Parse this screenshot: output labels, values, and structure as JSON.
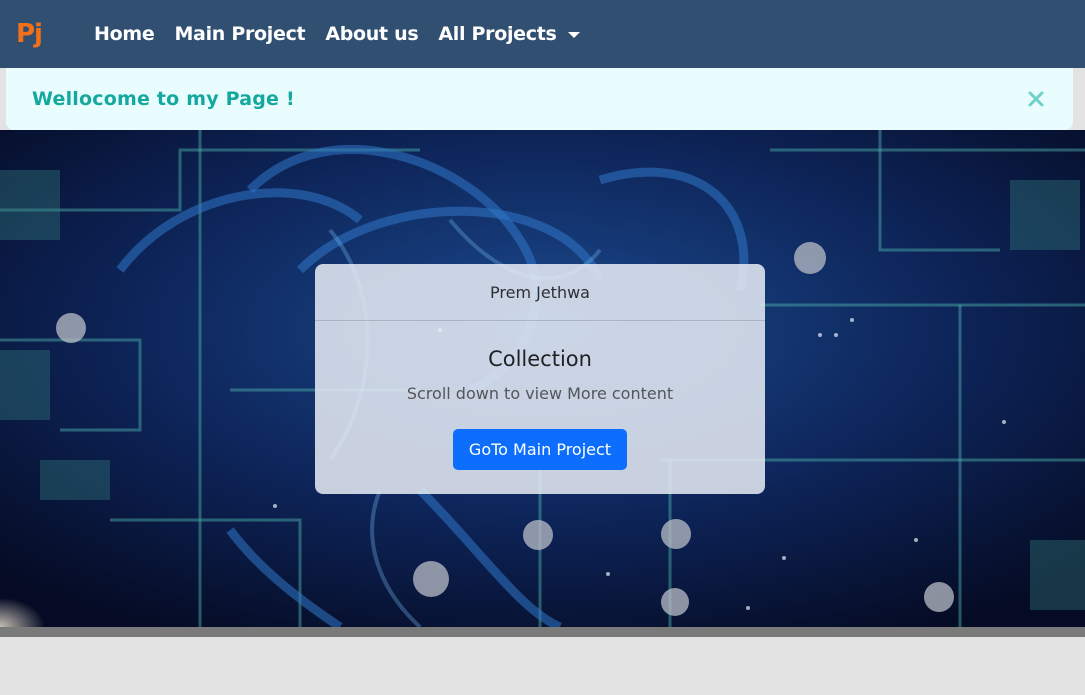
{
  "navbar": {
    "brand": "Pj",
    "links": [
      "Home",
      "Main Project",
      "About us"
    ],
    "dropdown_label": "All Projects",
    "background": "#304f71",
    "brand_color": "#f27118"
  },
  "alert": {
    "message": "Wellocome to my Page !",
    "close_icon": "close-icon",
    "text_color": "#14a89e"
  },
  "card": {
    "header": "Prem Jethwa",
    "title": "Collection",
    "text": "Scroll down to view More content",
    "button_label": "GoTo Main Project",
    "button_color": "#0d6efd"
  }
}
